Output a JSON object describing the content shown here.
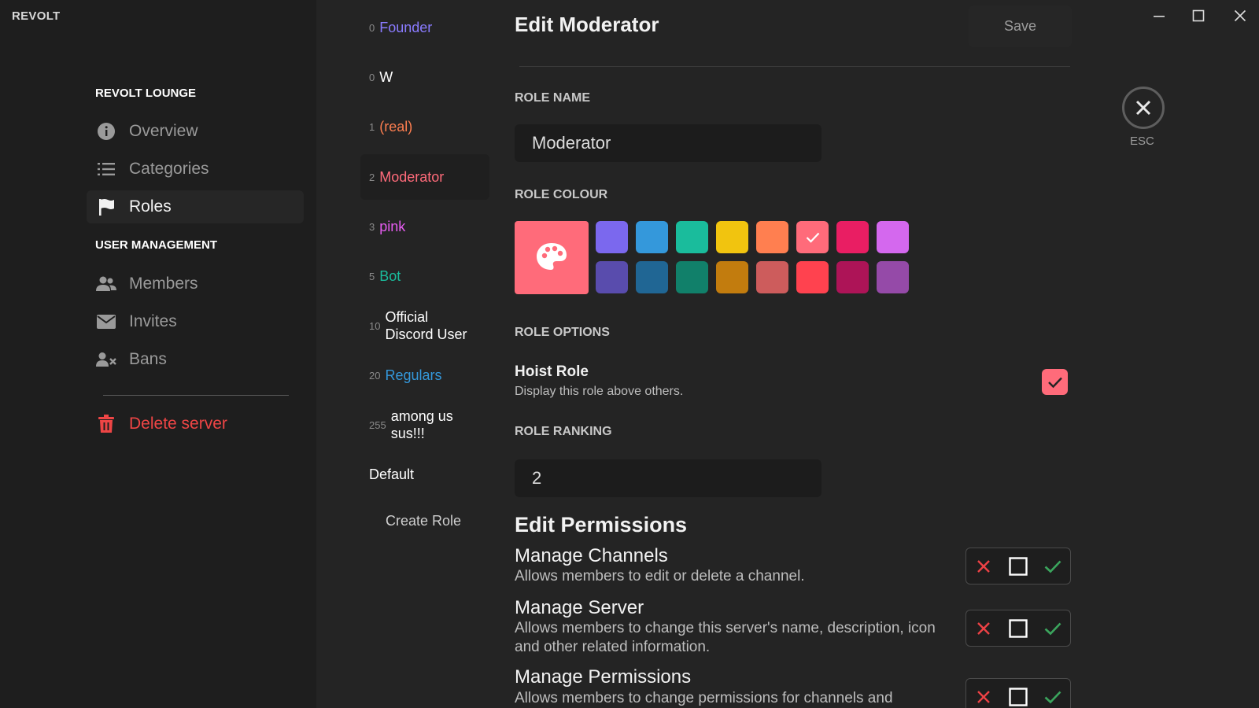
{
  "app": {
    "logo": "REVOLT"
  },
  "sidebar": {
    "server_section": "REVOLT LOUNGE",
    "server_items": [
      {
        "label": "Overview",
        "icon": "info-icon"
      },
      {
        "label": "Categories",
        "icon": "list-icon"
      },
      {
        "label": "Roles",
        "icon": "flag-icon",
        "active": true
      }
    ],
    "user_section": "USER MANAGEMENT",
    "user_items": [
      {
        "label": "Members",
        "icon": "users-icon"
      },
      {
        "label": "Invites",
        "icon": "envelope-icon"
      },
      {
        "label": "Bans",
        "icon": "user-x-icon"
      }
    ],
    "delete_label": "Delete server"
  },
  "roles": {
    "items": [
      {
        "rank": "0",
        "name": "Founder",
        "color": "#8a7bff"
      },
      {
        "rank": "0",
        "name": "W",
        "color": "#ffffff"
      },
      {
        "rank": "1",
        "name": "(real)",
        "color": "#ff7f50"
      },
      {
        "rank": "2",
        "name": "Moderator",
        "color": "#ff6b7a",
        "active": true
      },
      {
        "rank": "3",
        "name": "pink",
        "color": "#e75cf2"
      },
      {
        "rank": "5",
        "name": "Bot",
        "color": "#1abc9c"
      },
      {
        "rank": "10",
        "name": "Official Discord User",
        "color": "#ffffff"
      },
      {
        "rank": "20",
        "name": "Regulars",
        "color": "#3498db"
      },
      {
        "rank": "255",
        "name": "among us sus!!!",
        "color": "#ffffff"
      }
    ],
    "default_label": "Default",
    "create_label": "Create Role"
  },
  "editor": {
    "title": "Edit Moderator",
    "save_label": "Save",
    "role_name_label": "ROLE NAME",
    "role_name_value": "Moderator",
    "role_colour_label": "ROLE COLOUR",
    "selected_colour": "#ff6b7a",
    "swatches_top": [
      "#7b68ee",
      "#3498db",
      "#1abc9c",
      "#f1c40f",
      "#ff7f50",
      "#ff6b7a",
      "#e91e63",
      "#d468ee"
    ],
    "swatches_bottom": [
      "#594cad",
      "#206694",
      "#11806a",
      "#c27c0e",
      "#cd5c5c",
      "#ff424f",
      "#ad1457",
      "#954aa8"
    ],
    "selected_swatch_index": 5,
    "role_options_label": "ROLE OPTIONS",
    "hoist_title": "Hoist Role",
    "hoist_desc": "Display this role above others.",
    "hoist_checked": true,
    "role_ranking_label": "ROLE RANKING",
    "role_ranking_value": "2",
    "permissions_heading": "Edit Permissions",
    "permissions": [
      {
        "title": "Manage Channels",
        "desc": "Allows members to edit or delete a channel."
      },
      {
        "title": "Manage Server",
        "desc": "Allows members to change this server's name, description, icon and other related information."
      },
      {
        "title": "Manage Permissions",
        "desc": "Allows members to change permissions for channels and"
      }
    ]
  },
  "close": {
    "esc_label": "ESC"
  },
  "colors": {
    "deny": "#ed4245",
    "allow": "#3ba55d",
    "accent": "#ff6b7a"
  }
}
